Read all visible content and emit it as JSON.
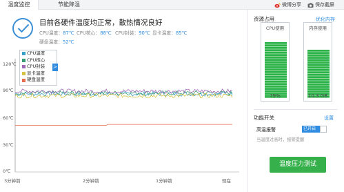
{
  "tabs": [
    {
      "label": "温度监控",
      "active": true
    },
    {
      "label": "节能降温",
      "active": false
    }
  ],
  "toolbar": {
    "weibo_share": "微博分享",
    "save_screenshot": "保存截屏"
  },
  "status": {
    "title": "目前各硬件温度均正常，散热情况良好",
    "readings": [
      {
        "label": "CPU温度：",
        "value": "87℃"
      },
      {
        "label": "CPU核心：",
        "value": "88℃"
      },
      {
        "label": "CPU封装：",
        "value": "90℃"
      },
      {
        "label": "显卡温度：",
        "value": "85℃"
      },
      {
        "label": "硬盘温度：",
        "value": "52℃"
      }
    ]
  },
  "chart_data": {
    "type": "line",
    "yticks": [
      "120℃",
      "90℃",
      "60℃",
      "30℃",
      "0℃"
    ],
    "xticks": [
      "3分钟前",
      "2分钟前",
      "1分钟前",
      "现在"
    ],
    "ylim": [
      0,
      120
    ],
    "legend": {
      "placement": "top-left",
      "arrow": ">"
    },
    "grid": false,
    "series": [
      {
        "name": "CPU温度",
        "color": "#3aa0c8",
        "approx_value": 87
      },
      {
        "name": "CPU核心",
        "color": "#3a9c74",
        "approx_value": 88
      },
      {
        "name": "CPU封装",
        "color": "#a06ab8",
        "approx_value": 90
      },
      {
        "name": "显卡温度",
        "color": "#d6c244",
        "approx_value": 85
      },
      {
        "name": "硬盘温度",
        "color": "#e36d4e",
        "approx_value": 52
      }
    ]
  },
  "resources": {
    "title": "资源占用",
    "optimize_link": "优化内存",
    "cpu": {
      "label": "CPU使用",
      "value": "79%",
      "fraction": 0.79
    },
    "mem": {
      "label": "内存使用",
      "value": "10.3 GB",
      "fraction": 0.68
    }
  },
  "switches": {
    "title": "功能开关",
    "settings_link": "设置",
    "high_temp_alarm": "高温报警",
    "toggle_label": "已开启",
    "hint": "当温度过高时，报警提醒"
  },
  "stress_test_button": "温度压力测试",
  "colors": {
    "accent": "#2f8ce0",
    "green": "#35b04a"
  }
}
